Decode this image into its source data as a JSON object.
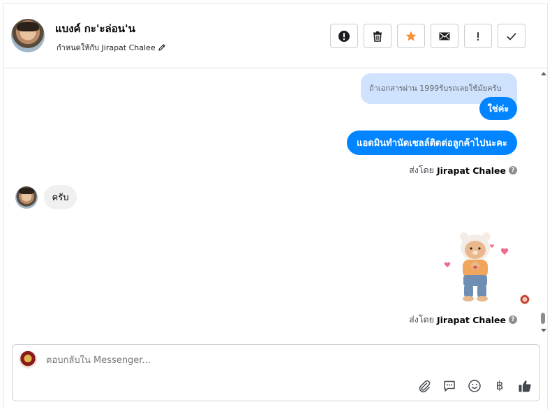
{
  "header": {
    "contact_name": "แบงค์ กะ'ะล่อน'น",
    "assigned_text": "กำหนดให้กับ Jirapat Chalee",
    "actions": [
      {
        "name": "alert-button",
        "icon": "exclamation-circle-icon"
      },
      {
        "name": "delete-button",
        "icon": "trash-icon"
      },
      {
        "name": "star-button",
        "icon": "star-icon",
        "color": "#f7923b"
      },
      {
        "name": "email-button",
        "icon": "envelope-icon"
      },
      {
        "name": "important-button",
        "icon": "exclamation-icon"
      },
      {
        "name": "done-button",
        "icon": "checkmark-icon"
      }
    ]
  },
  "messages": {
    "quoted_text": "ถ้าเอกสารผ่าน 1999รับรถเลยใช้มัยครับ",
    "reply_1": "ใช่ค่ะ",
    "reply_2": "แอดมินทำนัดเซลล์ติดต่อลูกค้าไปนะคะ",
    "sent_by_label": "ส่งโดย",
    "sent_by_name": "Jirapat Chalee",
    "incoming_text": "ครับ",
    "sent_by_label_2": "ส่งโดย",
    "sent_by_name_2": "Jirapat Chalee",
    "sticker": "teddy-bear-sticker"
  },
  "composer": {
    "placeholder": "ตอบกลับใน Messenger..."
  },
  "colors": {
    "bubble_out": "#0084ff",
    "bubble_quote": "#cfe3ff",
    "bubble_in": "#f0f0f0",
    "star": "#f7923b"
  }
}
